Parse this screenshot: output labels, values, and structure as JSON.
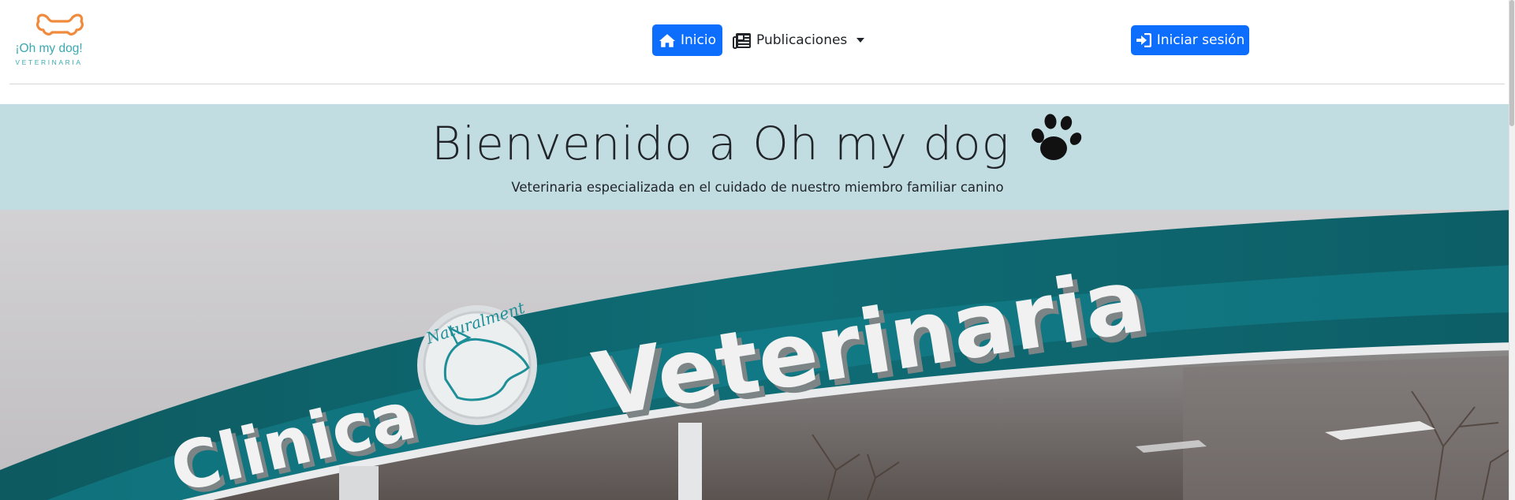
{
  "navbar": {
    "logo": {
      "name": "¡Oh my dog!",
      "subtitle": "VETERINARIA"
    },
    "nav_items": [
      {
        "label": "Inicio",
        "icon": "home-icon",
        "active": true
      },
      {
        "label": "Publicaciones",
        "icon": "newspaper-icon",
        "dropdown": true
      }
    ],
    "login_label": "Iniciar sesión",
    "login_icon": "sign-in-icon"
  },
  "hero": {
    "title": "Bienvenido a Oh my dog",
    "title_icon": "paw-icon",
    "subtitle": "Veterinaria especializada en el cuidado de nuestro miembro familiar canino"
  },
  "banner_photo": {
    "sign_text_main": "Veterinaria",
    "sign_text_left": "Clinica",
    "badge_text": "Naturalment"
  },
  "colors": {
    "primary": "#0d6efd",
    "hero_bg": "#c2dde2",
    "logo_orange": "#f08a3c",
    "logo_teal": "#3aa9b0",
    "sign_teal": "#0f6b74"
  }
}
